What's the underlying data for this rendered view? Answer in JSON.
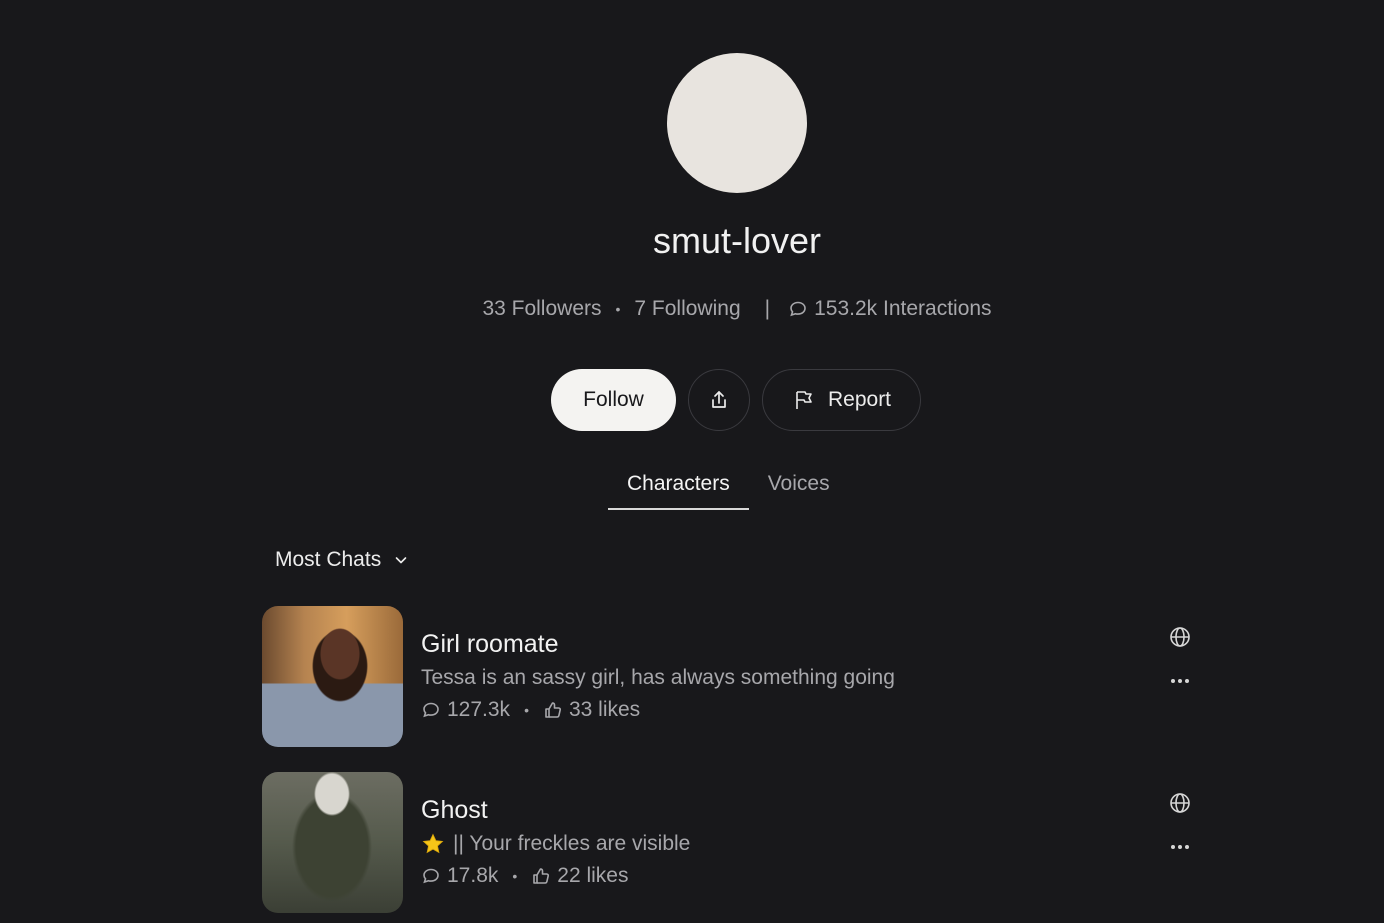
{
  "profile": {
    "username": "smut-lover",
    "followers": "33 Followers",
    "following": "7 Following",
    "separator": "|",
    "interactions": "153.2k Interactions",
    "stat_dot": "•"
  },
  "actions": {
    "follow_label": "Follow",
    "report_label": "Report"
  },
  "tabs": [
    {
      "label": "Characters",
      "active": true
    },
    {
      "label": "Voices",
      "active": false
    }
  ],
  "sort": {
    "label": "Most Chats"
  },
  "characters": [
    {
      "name": "Girl roomate",
      "description": "Tessa is an sassy girl, has always something going",
      "chats": "127.3k",
      "likes": "33 likes",
      "dot": "•"
    },
    {
      "name": "Ghost",
      "description": "|| Your freckles are visible",
      "badge_icon": "star-icon",
      "chats": "17.8k",
      "likes": "22 likes",
      "dot": "•"
    }
  ],
  "icons": {
    "share": "share-icon",
    "report": "flag-icon",
    "chat": "chat-bubble-icon",
    "like": "thumbs-up-icon",
    "globe": "globe-icon",
    "more": "more-icon",
    "chevron": "chevron-down-icon"
  },
  "colors": {
    "background": "#18181b",
    "follow_button": "#f4f3f1",
    "avatar": "#e8e4df",
    "star": "#f5c518"
  }
}
